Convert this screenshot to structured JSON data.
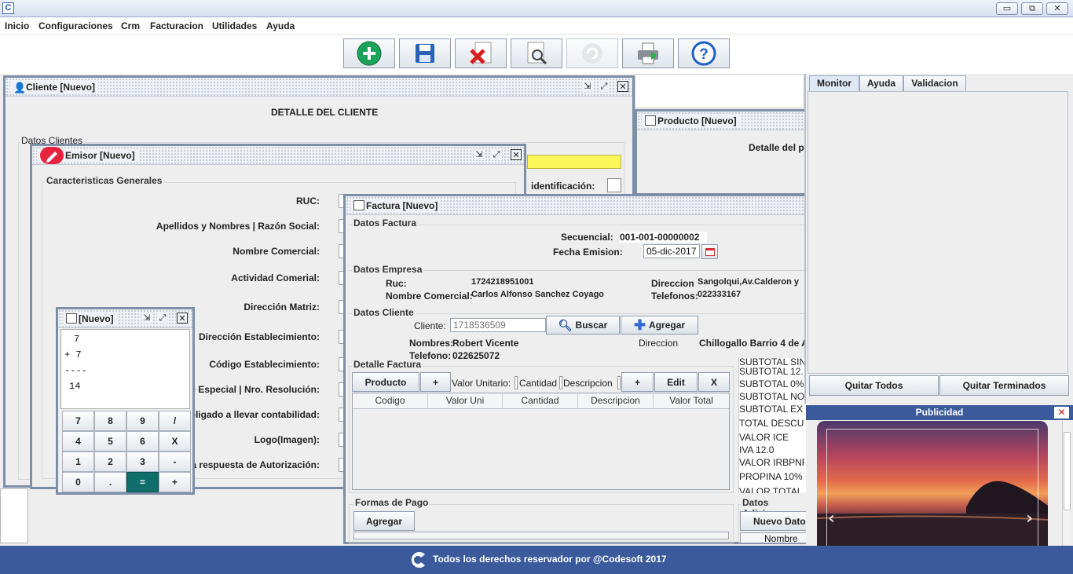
{
  "window": {
    "icon_letter": "C",
    "controls": [
      "▭",
      "⧉",
      "✕"
    ]
  },
  "menu": [
    "Inicio",
    "Configuraciones",
    "Crm",
    "Facturacion",
    "Utilidades",
    "Ayuda"
  ],
  "toolbar": {
    "icons": [
      "add-icon",
      "save-icon",
      "delete-icon",
      "search-icon",
      "refresh-icon",
      "print-icon",
      "help-icon"
    ],
    "colors": {
      "add": "#19a45a",
      "save": "#2a63b5",
      "help": "#1d5fc2"
    }
  },
  "cliente": {
    "title": "Cliente [Nuevo]",
    "heading": "DETALLE DEL CLIENTE",
    "group": "Datos Clientes",
    "ident_label": "identificación:"
  },
  "producto": {
    "title": "Producto [Nuevo]",
    "heading": "Detalle del p"
  },
  "emisor": {
    "title": "Emisor [Nuevo]",
    "group": "Caracteristicas Generales",
    "labels": [
      "RUC:",
      "Apellidos y Nombres | Razón Social:",
      "Nombre Comercial:",
      "Actividad Comerial:",
      "Dirección Matriz:",
      "Dirección Establecimiento:",
      "Código Establecimiento:",
      "te Especial | Nro. Resolución:",
      "bligado a llevar contabilidad:",
      "Logo(Imagen):",
      "a respuesta de Autorización:"
    ]
  },
  "calc": {
    "title": "[Nuevo]",
    "display": [
      "7",
      "+ 7",
      "----",
      "14"
    ],
    "keys": [
      [
        "7",
        "8",
        "9",
        "/"
      ],
      [
        "4",
        "5",
        "6",
        "X"
      ],
      [
        "1",
        "2",
        "3",
        "-"
      ],
      [
        "0",
        ".",
        "=",
        "+"
      ]
    ]
  },
  "factura": {
    "title": "Factura [Nuevo]",
    "datos_factura": {
      "label": "Datos Factura",
      "secuencial_label": "Secuencial:",
      "secuencial": "001-001-00000002",
      "fecha_label": "Fecha Emision:",
      "fecha": "05-dic-2017"
    },
    "datos_empresa": {
      "label": "Datos Empresa",
      "ruc_label": "Ruc:",
      "ruc": "1724218951001",
      "nombre_label": "Nombre Comercial:",
      "nombre": "Carlos Alfonso Sanchez Coyago",
      "direccion_label": "Direccion",
      "direccion": "Sangolqui,Av.Calderon y",
      "telefonos_label": "Telefonos:",
      "telefonos": "022333167"
    },
    "datos_cliente": {
      "label": "Datos Cliente",
      "cliente_label": "Cliente:",
      "cliente_placeholder": "1718536509",
      "buscar": "Buscar",
      "agregar": "Agregar",
      "nombres_label": "Nombres:",
      "nombres": "Robert Vicente",
      "direccion_label": "Direccion",
      "direccion": "Chillogallo Barrio 4 de A",
      "telefono_label": "Telefono:",
      "telefono": "022625072"
    },
    "detalle": {
      "label": "Detalle Factura",
      "producto_btn": "Producto",
      "plus": "+",
      "vu_label": "Valor Unitario:",
      "cant_label": "Cantidad",
      "desc_label": "Descripcion",
      "plus2": "+",
      "edit": "Edit",
      "x": "X",
      "columns": [
        "Codigo",
        "Valor Uni",
        "Cantidad",
        "Descripcion",
        "Valor Total"
      ]
    },
    "totales": [
      "SUBTOTAL SIN",
      "SUBTOTAL 12.",
      "SUBTOTAL 0%",
      "SUBTOTAL NO",
      "SUBTOTAL EX",
      "TOTAL DESCU",
      "VALOR ICE",
      "IVA 12.0",
      "VALOR IRBPNR",
      "PROPINA 10%",
      "VALOR TOTAL"
    ],
    "formas_pago": {
      "label": "Formas de Pago",
      "agregar": "Agregar"
    },
    "adicionales": {
      "label": "Datos Adicion",
      "nuevo": "Nuevo Dato",
      "col": "Nombre"
    }
  },
  "side": {
    "tabs": [
      "Monitor",
      "Ayuda",
      "Validacion"
    ],
    "quitar_todos": "Quitar Todos",
    "quitar_terminados": "Quitar Terminados",
    "publicidad": "Publicidad"
  },
  "footer": {
    "text": "Todos los derechos reservador por @Codesoft 2017"
  }
}
